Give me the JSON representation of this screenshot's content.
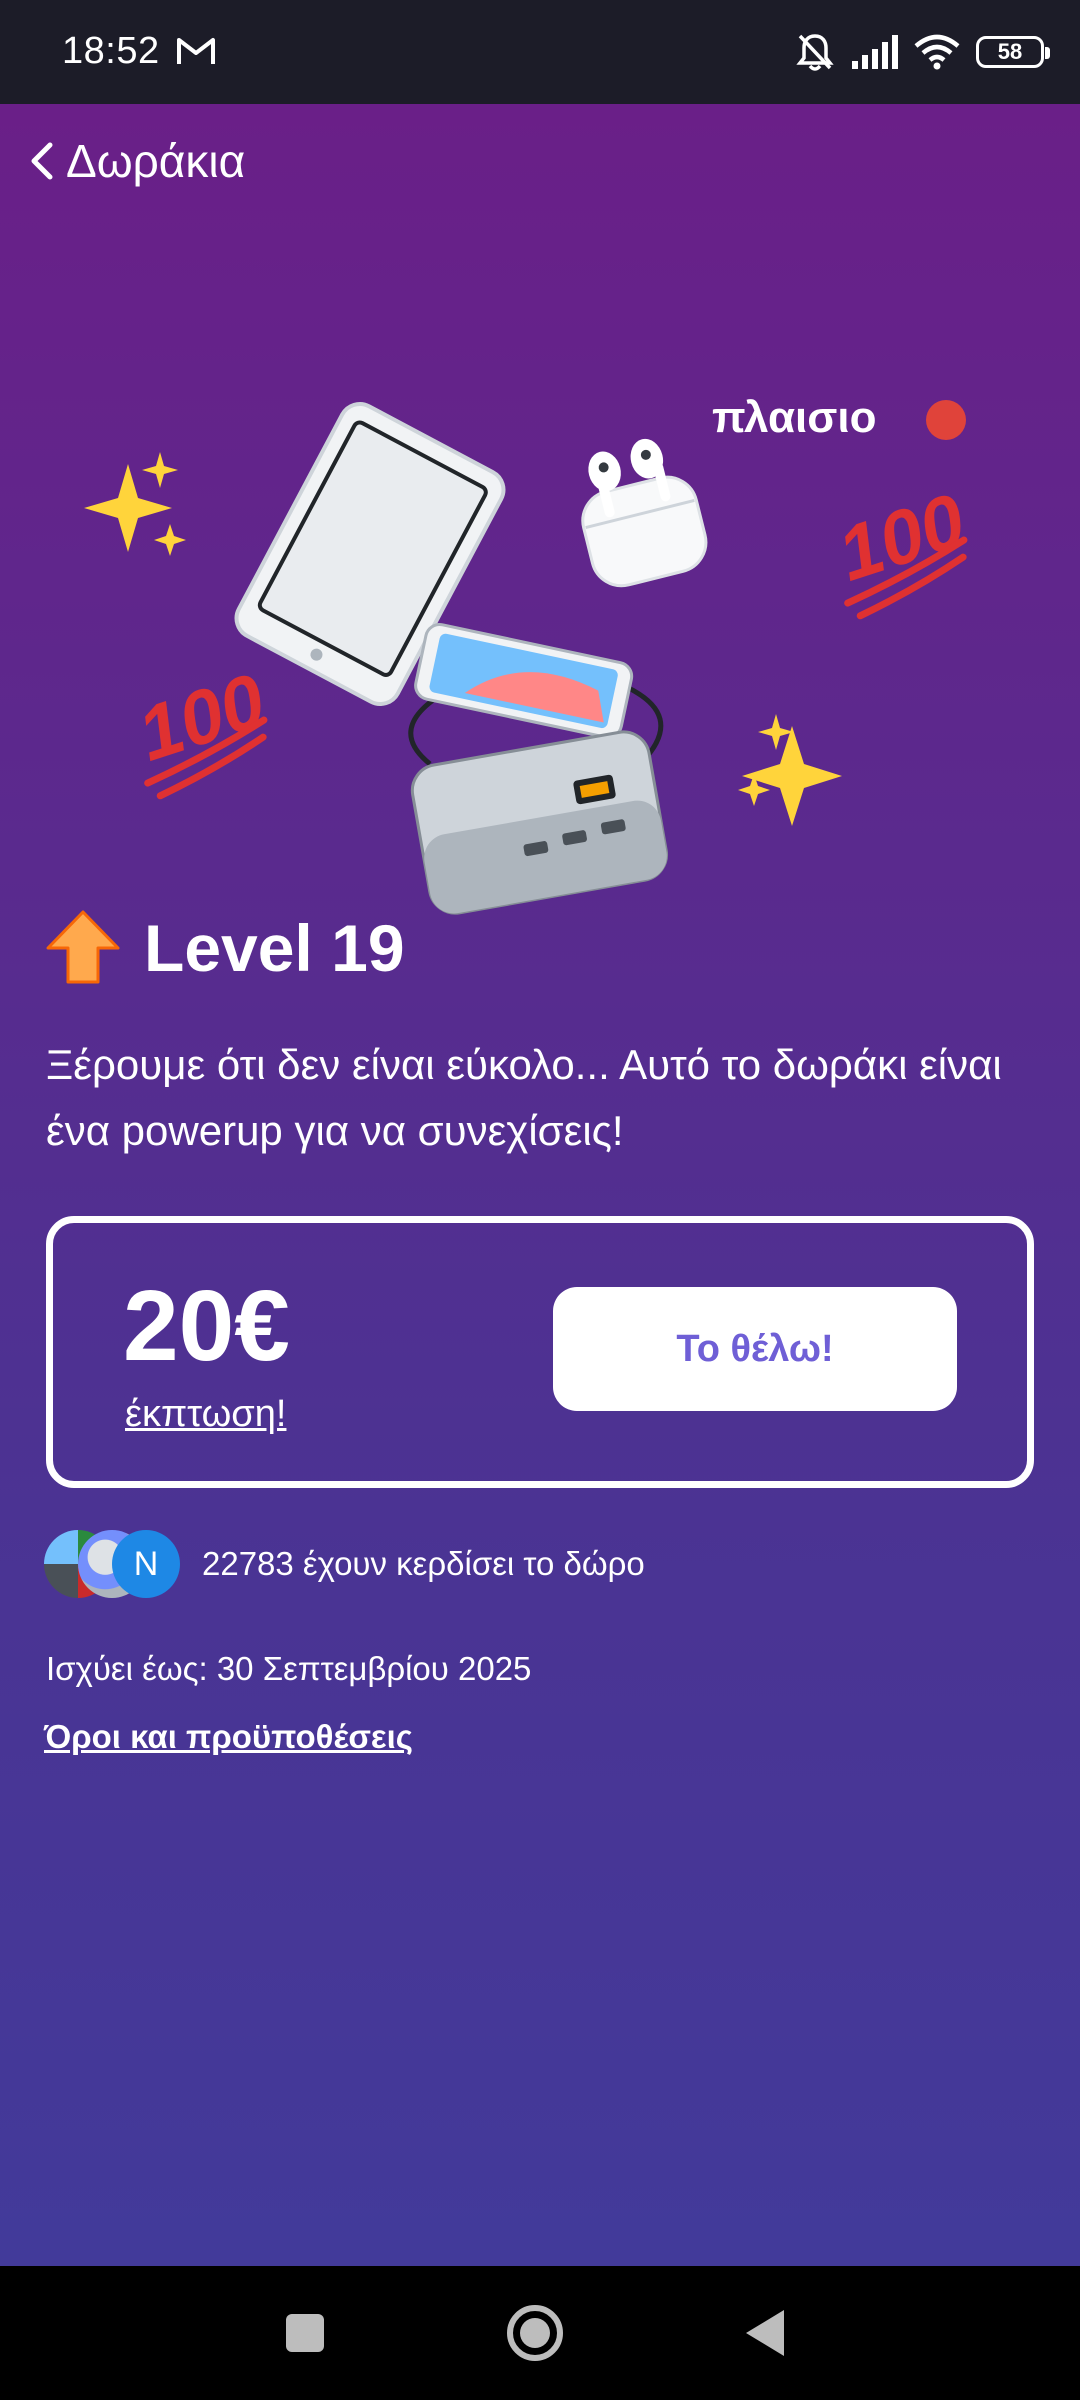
{
  "status": {
    "time": "18:52",
    "battery": "58",
    "icons": [
      "gmail-icon",
      "bell-off-icon",
      "signal-icon",
      "wifi-icon",
      "battery-icon"
    ]
  },
  "header": {
    "back_label": "Δωράκια"
  },
  "hero": {
    "brand": "πλαισιο",
    "emoji_labels": [
      "100",
      "100"
    ],
    "icons": [
      "sparkles-icon",
      "tablet-icon",
      "earbuds-icon",
      "smartphone-icon",
      "powerbank-icon",
      "hundred-points-icon"
    ]
  },
  "level": {
    "title": "Level 19",
    "icon": "up-arrow-icon"
  },
  "description": "Ξέρουμε ότι δεν είναι εύκολο... Αυτό το δωράκι είναι ένα powerup για να συνεχίσεις!",
  "offer": {
    "amount": "20€",
    "subtitle": "έκπτωση!",
    "cta_label": "Το θέλω!"
  },
  "winners": {
    "avatar_initial": "N",
    "text": "22783 έχουν κερδίσει το δώρο"
  },
  "valid_until": "Ισχύει έως: 30 Σεπτεμβρίου 2025",
  "terms_label": "Όροι και προϋποθέσεις",
  "colors": {
    "accent": "#6f5fd6",
    "bg_top": "#6a1f88",
    "bg_bottom": "#423a9a"
  }
}
